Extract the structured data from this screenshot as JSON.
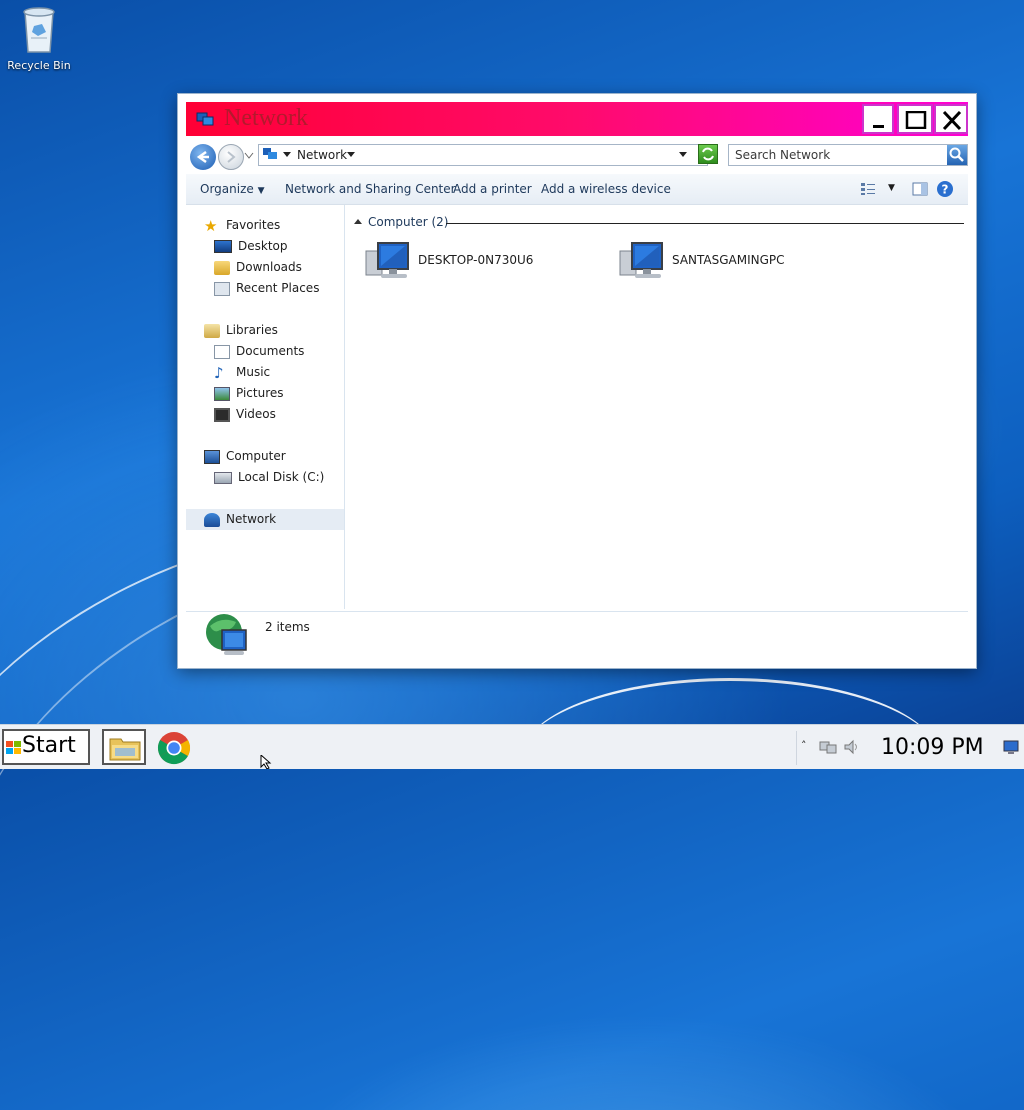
{
  "desktop": {
    "recycle_bin_label": "Recycle Bin"
  },
  "window": {
    "title": "Network",
    "address_location": "Network",
    "search_placeholder": "Search Network",
    "toolbar": {
      "organize": "Organize",
      "network_center": "Network and Sharing Center",
      "add_printer": "Add a printer",
      "add_wireless": "Add a wireless device"
    },
    "nav": {
      "favorites": "Favorites",
      "desktop": "Desktop",
      "downloads": "Downloads",
      "recent_places": "Recent Places",
      "libraries": "Libraries",
      "documents": "Documents",
      "music": "Music",
      "pictures": "Pictures",
      "videos": "Videos",
      "computer": "Computer",
      "local_disk": "Local Disk (C:)",
      "network": "Network"
    },
    "group_header": "Computer (2)",
    "computers": [
      "DESKTOP-0N730U6",
      "SANTASGAMINGPC"
    ],
    "status_items": "2 items"
  },
  "taskbar": {
    "start_label": "Start",
    "clock": "10:09 PM"
  },
  "colors": {
    "titlebar_gradient": [
      "#ff0035",
      "#ff00d4"
    ],
    "title_text": "#b21a2d",
    "title_button_border": "#cc33cc"
  }
}
